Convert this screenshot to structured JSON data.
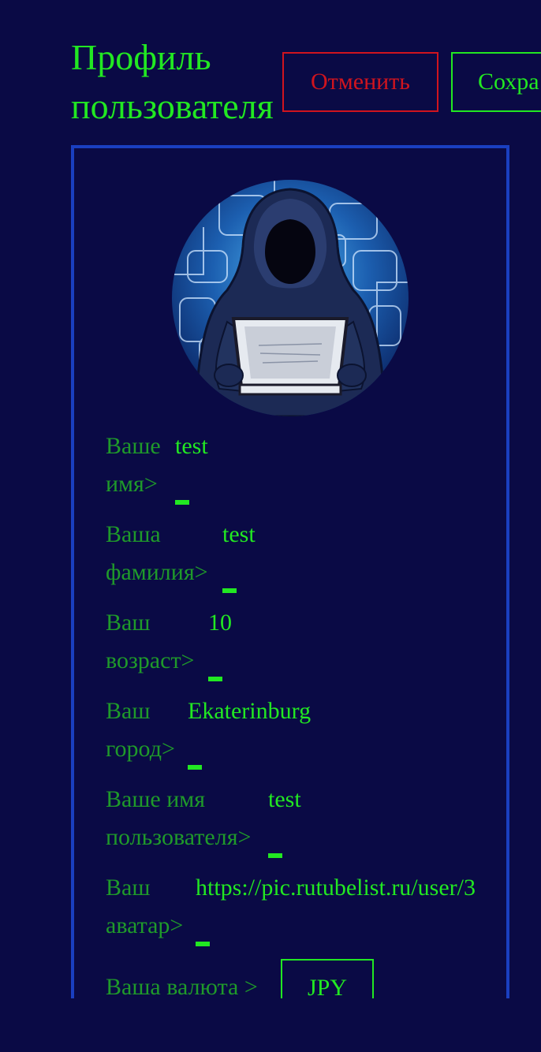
{
  "header": {
    "title": "Профиль пользователя",
    "cancel_label": "Отменить",
    "save_label": "Сохра"
  },
  "colors": {
    "background": "#0a0a45",
    "accent_green": "#22e822",
    "label_green": "#1f9a2a",
    "cancel_red": "#d0141e",
    "panel_border": "#1a3fc0"
  },
  "avatar": {
    "icon": "hooded-hacker-avatar"
  },
  "fields": [
    {
      "label": "Ваше имя>",
      "value": "test"
    },
    {
      "label": "Ваша фамилия>",
      "value": "test"
    },
    {
      "label": "Ваш возраст>",
      "value": "10"
    },
    {
      "label": "Ваш город>",
      "value": "Ekaterinburg"
    },
    {
      "label": "Ваше имя пользователя>",
      "value": "test"
    },
    {
      "label": "Ваш аватар>",
      "value": "https://pic.rutubelist.ru/user/3"
    }
  ],
  "currency": {
    "label": "Ваша валюта >",
    "value": "JPY"
  }
}
